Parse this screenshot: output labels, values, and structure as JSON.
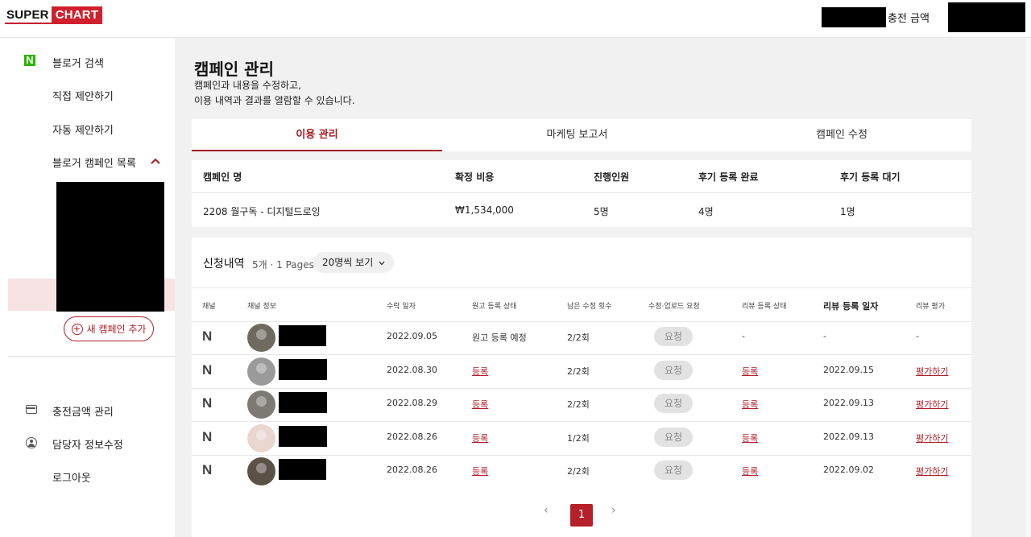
{
  "logo": {
    "part1": "SUPER",
    "part2": "CHART"
  },
  "topbar": {
    "charge_label": "충전 금액"
  },
  "sidebar": {
    "items": [
      {
        "label": "블로거 검색",
        "icon": "naver-n-icon"
      },
      {
        "label": "직접 제안하기"
      },
      {
        "label": "자동 제안하기"
      },
      {
        "label": "블로거 캠페인 목록",
        "icon": "chevron-up-icon"
      }
    ],
    "new_campaign": "새 캠페인 추가",
    "bottom": [
      {
        "label": "충전금액 관리",
        "icon": "card-icon"
      },
      {
        "label": "담당자 정보수정",
        "icon": "user-icon"
      },
      {
        "label": "로그아웃"
      }
    ]
  },
  "main": {
    "title": "캠페인 관리",
    "desc1": "캠페인과 내용을 수정하고,",
    "desc2": "이용 내역과 결과를 열람할 수 있습니다.",
    "tabs": [
      "이용 관리",
      "마케팅 보고서",
      "캠페인 수정"
    ],
    "active_tab": 0
  },
  "summary": {
    "headers": [
      "캠페인 명",
      "확정 비용",
      "진행인원",
      "후기 등록 완료",
      "후기 등록 대기"
    ],
    "values": [
      "2208 월구독 - 디지털드로잉",
      "₩1,534,000",
      "5명",
      "4명",
      "1명"
    ]
  },
  "applications": {
    "title": "신청내역",
    "meta": "5개 · 1 Pages",
    "per_page": "20명씩 보기",
    "headers": [
      "채널",
      "채널 정보",
      "수락 일자",
      "원고 등록 상태",
      "남은 수정 횟수",
      "수정·업로드 요청",
      "리뷰 등록 상태",
      "리뷰 등록 일자",
      "리뷰 평가"
    ],
    "request_label": "요청",
    "rows": [
      {
        "accepted": "2022.09.05",
        "draft": "원고 등록 예정",
        "remaining": "2/2회",
        "review_status": "-",
        "review_date": "-",
        "rating": "-"
      },
      {
        "accepted": "2022.08.30",
        "draft": "등록",
        "remaining": "2/2회",
        "review_status": "등록",
        "review_date": "2022.09.15",
        "rating": "평가하기"
      },
      {
        "accepted": "2022.08.29",
        "draft": "등록",
        "remaining": "2/2회",
        "review_status": "등록",
        "review_date": "2022.09.13",
        "rating": "평가하기"
      },
      {
        "accepted": "2022.08.26",
        "draft": "등록",
        "remaining": "1/2회",
        "review_status": "등록",
        "review_date": "2022.09.13",
        "rating": "평가하기"
      },
      {
        "accepted": "2022.08.26",
        "draft": "등록",
        "remaining": "2/2회",
        "review_status": "등록",
        "review_date": "2022.09.02",
        "rating": "평가하기"
      }
    ],
    "pagination": {
      "prev": "‹",
      "current": "1",
      "next": "›"
    }
  }
}
